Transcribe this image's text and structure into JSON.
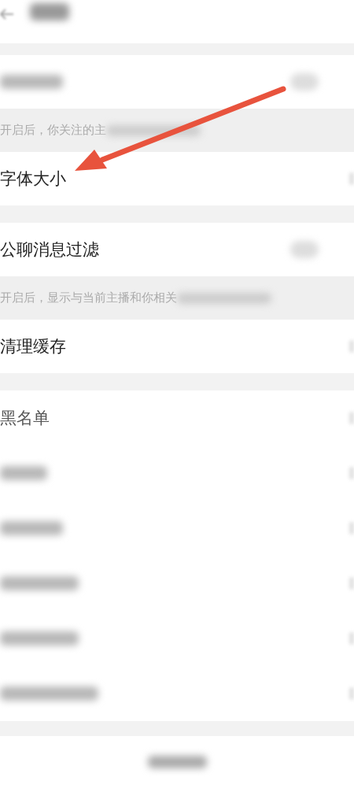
{
  "sections": [
    {
      "rows": [
        {
          "kind": "toggle",
          "blurred": true,
          "on": false
        }
      ],
      "hint": {
        "text": "开启后，你关注的主"
      }
    },
    {
      "rows": [
        {
          "kind": "link",
          "label": "字体大小"
        }
      ]
    },
    {
      "rows": [
        {
          "kind": "toggle",
          "label": "公聊消息过滤",
          "on": false
        }
      ],
      "hint": {
        "text": "开启后，显示与当前主播和你相关"
      }
    },
    {
      "rows": [
        {
          "kind": "link",
          "label": "清理缓存"
        }
      ]
    },
    {
      "rows": [
        {
          "kind": "link",
          "label": "黑名单"
        },
        {
          "kind": "link",
          "blurred": true
        },
        {
          "kind": "link",
          "blurred": true
        },
        {
          "kind": "link",
          "blurred": true
        },
        {
          "kind": "link",
          "blurred": true
        },
        {
          "kind": "link",
          "blurred": true
        }
      ]
    }
  ]
}
